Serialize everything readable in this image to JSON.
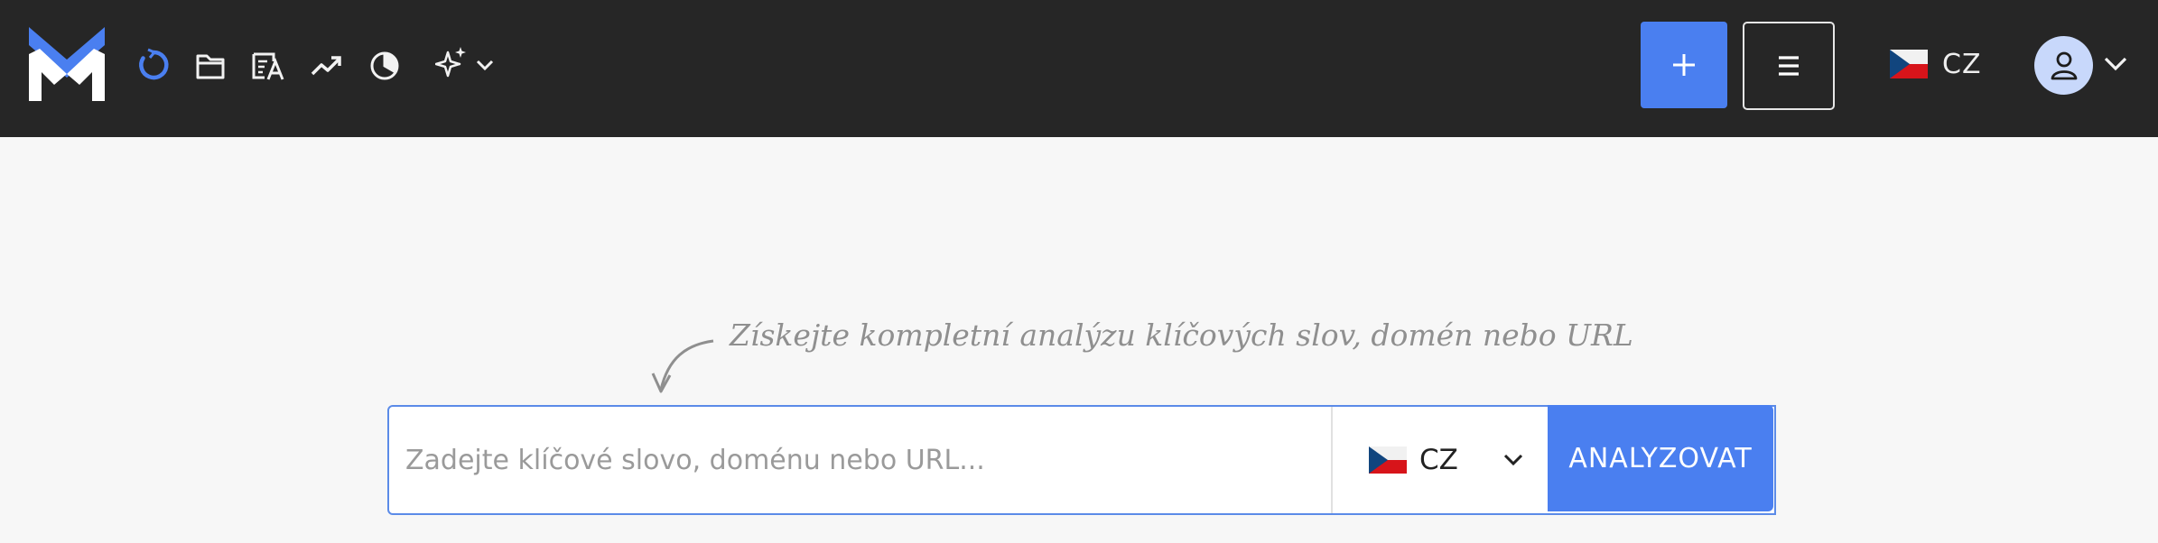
{
  "header": {
    "logo_name": "app-logo",
    "nav_icons": [
      "refresh-circle-icon",
      "folder-icon",
      "translate-doc-icon",
      "trend-up-icon",
      "pie-chart-icon",
      "sparkles-icon"
    ],
    "add_label": "+",
    "language": {
      "flag": "czech-flag",
      "code": "CZ"
    },
    "accent_color": "#4a7ff0"
  },
  "main": {
    "hint": "Získejte kompletní analýzu klíčových slov, domén nebo URL",
    "search": {
      "placeholder": "Zadejte klíčové slovo, doménu nebo URL...",
      "value": ""
    },
    "country": {
      "flag": "czech-flag",
      "code": "CZ"
    },
    "analyze_label": "ANALYZOVAT"
  }
}
